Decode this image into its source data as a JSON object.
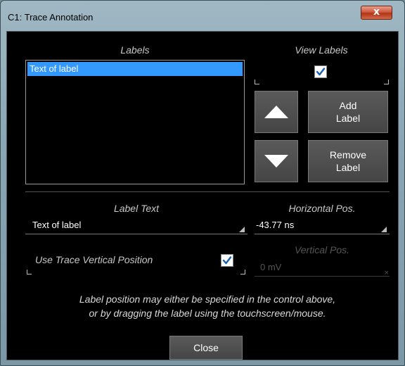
{
  "window": {
    "title": "C1: Trace Annotation",
    "close_glyph": "x"
  },
  "labels_section": {
    "heading": "Labels",
    "items": [
      "Text of label"
    ],
    "selected_index": 0
  },
  "view_labels": {
    "heading": "View Labels",
    "checked": true
  },
  "buttons": {
    "move_up_icon": "up-arrow-icon",
    "move_down_icon": "down-arrow-icon",
    "add_label": "Add\nLabel",
    "remove_label": "Remove\nLabel",
    "close": "Close"
  },
  "label_text": {
    "heading": "Label Text",
    "value": "Text of label"
  },
  "horizontal_pos": {
    "heading": "Horizontal Pos.",
    "value": "-43.77 ns"
  },
  "use_trace_vertical": {
    "label": "Use Trace Vertical Position",
    "checked": true
  },
  "vertical_pos": {
    "heading": "Vertical Pos.",
    "value": "0 mV",
    "disabled": true
  },
  "info_text": {
    "line1": "Label position may either be specified in the control above,",
    "line2": "or by dragging the label using the touchscreen/mouse."
  },
  "colors": {
    "selection": "#3399ff",
    "panel_bg": "#000000",
    "button_bg": "#505050",
    "close_x": "#c8472b"
  }
}
